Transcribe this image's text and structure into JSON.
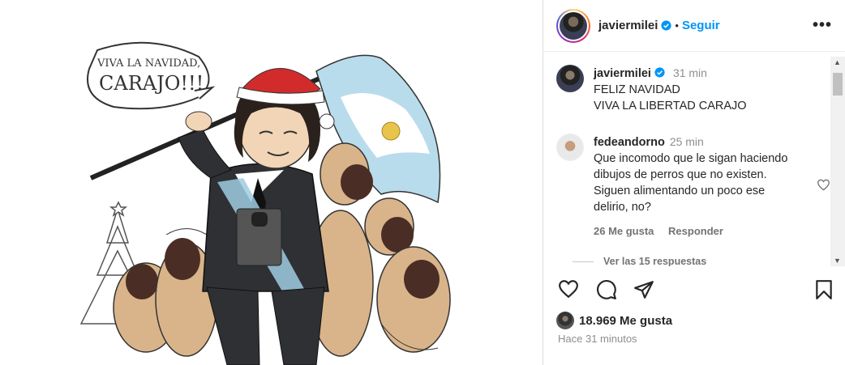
{
  "post": {
    "speech_line1": "VIVA LA NAVIDAD,",
    "speech_line2": "CARAJO!!!"
  },
  "header": {
    "username": "javiermilei",
    "separator": "•",
    "follow_label": "Seguir",
    "more_label": "•••"
  },
  "caption": {
    "username": "javiermilei",
    "time": "31 min",
    "line1": "FELIZ NAVIDAD",
    "line2": "VIVA LA LIBERTAD CARAJO"
  },
  "comment": {
    "username": "fedeandorno",
    "time": "25 min",
    "text": "Que incomodo que le sigan haciendo dibujos de perros que no existen. Siguen alimentando un poco ese delirio, no?",
    "likes_label": "26 Me gusta",
    "reply_label": "Responder",
    "view_replies_label": "Ver las 15 respuestas"
  },
  "footer": {
    "likes_count": "18.969 Me gusta",
    "time_ago": "Hace 31 minutos"
  },
  "icons": {
    "like": "heart-icon",
    "comment": "comment-icon",
    "share": "share-icon",
    "save": "bookmark-icon",
    "verified": "verified-badge-icon"
  },
  "colors": {
    "follow": "#0095f6",
    "verified": "#0095f6",
    "muted": "#8e8e8e"
  }
}
